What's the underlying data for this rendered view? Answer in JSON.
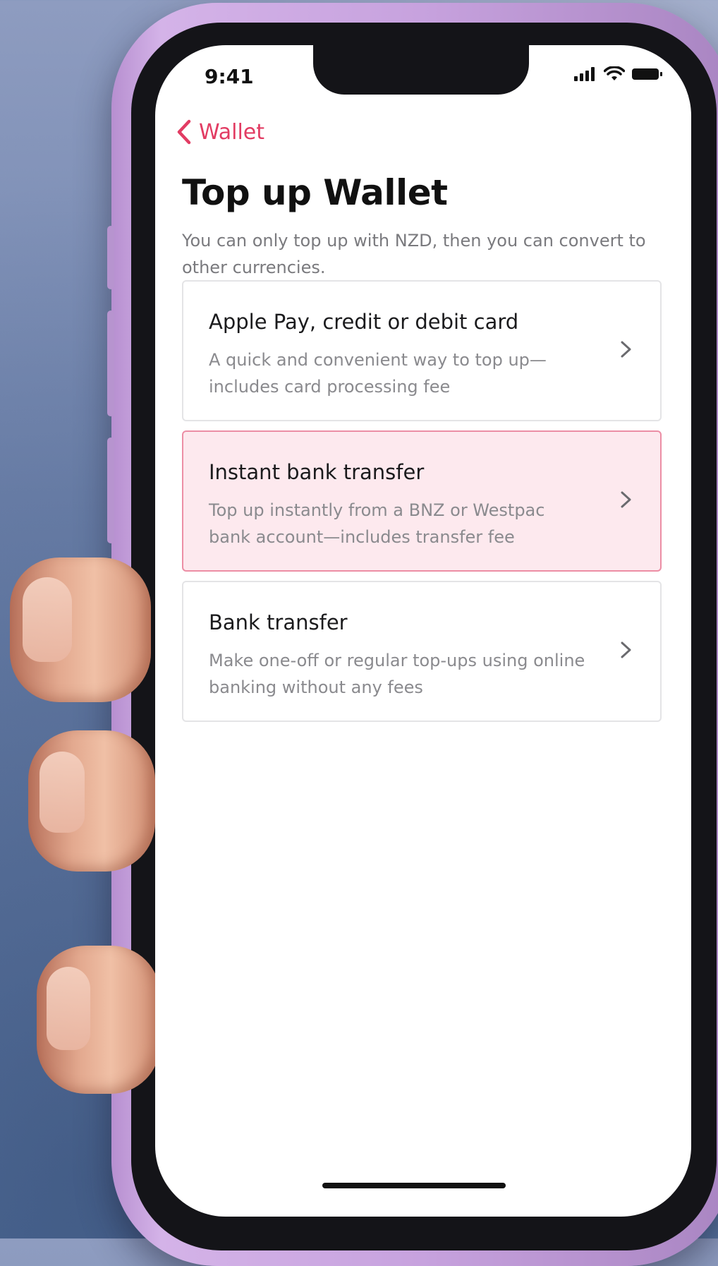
{
  "status_bar": {
    "time": "9:41",
    "icons": [
      "cellular-signal-icon",
      "wifi-icon",
      "battery-icon"
    ]
  },
  "nav": {
    "back_label": "Wallet",
    "back_icon": "chevron-left-icon"
  },
  "page": {
    "title": "Top up Wallet",
    "subtitle": "You can only top up with NZD, then you can convert to other currencies."
  },
  "options": [
    {
      "title": "Apple Pay, credit or debit card",
      "description": "A quick and convenient way to top up—includes card processing fee",
      "highlighted": false
    },
    {
      "title": "Instant bank transfer",
      "description": "Top up instantly from a BNZ or Westpac bank account—includes transfer fee",
      "highlighted": true
    },
    {
      "title": "Bank transfer",
      "description": "Make one-off or regular top-ups using online banking without any fees",
      "highlighted": false
    }
  ],
  "colors": {
    "accent": "#e23c63",
    "highlight_bg": "#fde9ee",
    "highlight_border": "#ec8ea5",
    "phone_case": "#c7a2de",
    "background": "#6f84ad"
  }
}
